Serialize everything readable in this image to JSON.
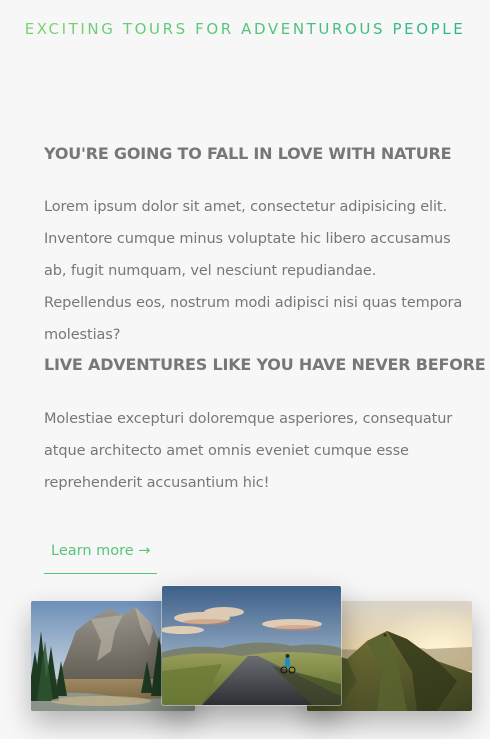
{
  "header": {
    "tagline": "EXCITING TOURS FOR ADVENTUROUS PEOPLE"
  },
  "about": {
    "heading_1": "YOU'RE GOING TO FALL IN LOVE WITH NATURE",
    "paragraph_1": "Lorem ipsum dolor sit amet, consectetur adipisicing elit. Inventore cumque minus voluptate hic libero accusamus ab, fugit numquam, vel nesciunt repudiandae. Repellendus eos, nostrum modi adipisci nisi quas tempora molestias?",
    "heading_2": "LIVE ADVENTURES LIKE YOU HAVE NEVER BEFORE",
    "paragraph_2": "Molestiae excepturi doloremque asperiores, consequatur atque architecto amet omnis eveniet cumque esse reprehenderit accusantium hic!",
    "link_label": "Learn more →"
  },
  "gallery": {
    "photos": [
      {
        "subject": "forest-valley-cliffs"
      },
      {
        "subject": "road-through-hills"
      },
      {
        "subject": "mountain-ridge-sunset"
      }
    ]
  },
  "colors": {
    "accent_light": "#7ed56f",
    "accent_dark": "#28b485",
    "link": "#55c57a",
    "text": "#777777",
    "background": "#f7f7f7"
  }
}
